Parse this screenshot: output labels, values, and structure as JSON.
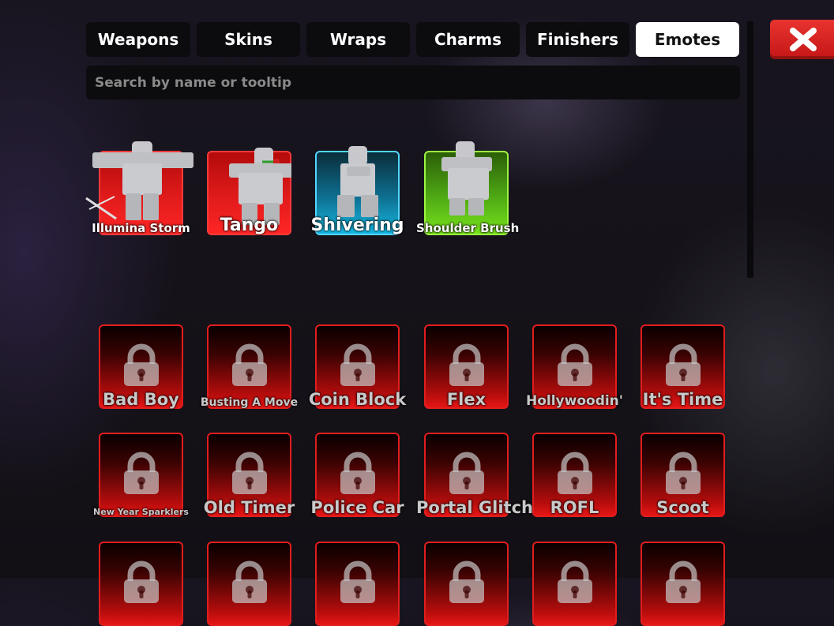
{
  "tabs": [
    {
      "label": "Weapons",
      "active": false
    },
    {
      "label": "Skins",
      "active": false
    },
    {
      "label": "Wraps",
      "active": false
    },
    {
      "label": "Charms",
      "active": false
    },
    {
      "label": "Finishers",
      "active": false
    },
    {
      "label": "Emotes",
      "active": true
    }
  ],
  "search": {
    "placeholder": "Search by name or tooltip",
    "value": ""
  },
  "close": {
    "icon": "close-x-icon",
    "color": "#d91f1f"
  },
  "owned": [
    {
      "name": "Illumina Storm",
      "rarity": "red"
    },
    {
      "name": "Tango",
      "rarity": "red"
    },
    {
      "name": "Shivering",
      "rarity": "cyan"
    },
    {
      "name": "Shoulder Brush",
      "rarity": "green"
    }
  ],
  "locked": [
    {
      "name": "Bad Boy"
    },
    {
      "name": "Busting A Move"
    },
    {
      "name": "Coin Block"
    },
    {
      "name": "Flex"
    },
    {
      "name": "Hollywoodin'"
    },
    {
      "name": "It's Time"
    },
    {
      "name": "New Year Sparklers"
    },
    {
      "name": "Old Timer"
    },
    {
      "name": "Police Car"
    },
    {
      "name": "Portal Glitch"
    },
    {
      "name": "ROFL"
    },
    {
      "name": "Scoot"
    }
  ],
  "colors": {
    "accent": "#ffffff",
    "locked": "#e21d1d",
    "rare_red": "#e01b1b",
    "rare_cyan": "#16b8e2",
    "rare_green": "#4fa914"
  }
}
